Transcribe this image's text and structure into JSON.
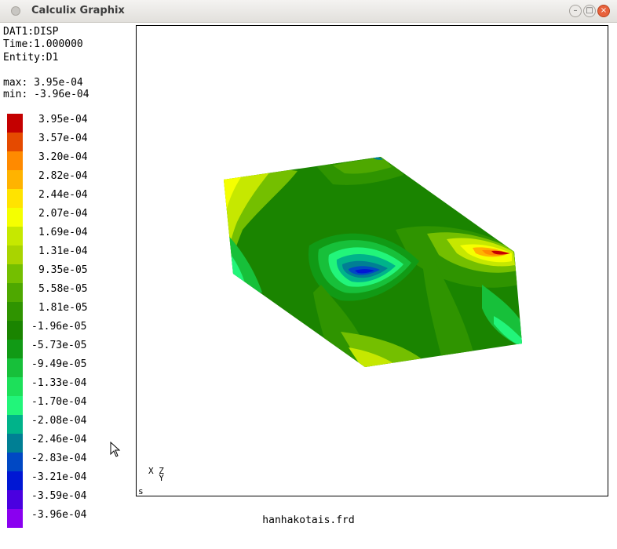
{
  "window": {
    "title": "Calculix Graphix",
    "controls": {
      "minimize": "–",
      "maximize": "□",
      "close": "×"
    }
  },
  "info": {
    "dataset": "DAT1:DISP",
    "time": "Time:1.000000",
    "entity": "Entity:D1",
    "max": "max: 3.95e-04",
    "min": "min: -3.96e-04"
  },
  "legend": [
    {
      "label": "3.95e-04",
      "color": "#c40000"
    },
    {
      "label": "3.57e-04",
      "color": "#e54a00"
    },
    {
      "label": "3.20e-04",
      "color": "#ff8a00"
    },
    {
      "label": "2.82e-04",
      "color": "#ffb300"
    },
    {
      "label": "2.44e-04",
      "color": "#ffe300"
    },
    {
      "label": "2.07e-04",
      "color": "#f5ff00"
    },
    {
      "label": "1.69e-04",
      "color": "#c6e800"
    },
    {
      "label": "1.31e-04",
      "color": "#a9d400"
    },
    {
      "label": "9.35e-05",
      "color": "#74bf00"
    },
    {
      "label": "5.58e-05",
      "color": "#4ea800"
    },
    {
      "label": "1.81e-05",
      "color": "#2f9400"
    },
    {
      "label": "-1.96e-05",
      "color": "#1a8400"
    },
    {
      "label": "-5.73e-05",
      "color": "#119a15"
    },
    {
      "label": "-9.49e-05",
      "color": "#17c03a"
    },
    {
      "label": "-1.33e-04",
      "color": "#1de05a"
    },
    {
      "label": "-1.70e-04",
      "color": "#22f57a"
    },
    {
      "label": "-2.08e-04",
      "color": "#00b38a"
    },
    {
      "label": "-2.46e-04",
      "color": "#007f94"
    },
    {
      "label": "-2.83e-04",
      "color": "#0048c4"
    },
    {
      "label": "-3.21e-04",
      "color": "#0017d4"
    },
    {
      "label": "-3.59e-04",
      "color": "#4a00e0"
    },
    {
      "label": "-3.96e-04",
      "color": "#8a00f0"
    }
  ],
  "viewport": {
    "axes": "X Z\n  Y",
    "corner_mark": "s"
  },
  "filename": "hanhakotais.frd"
}
